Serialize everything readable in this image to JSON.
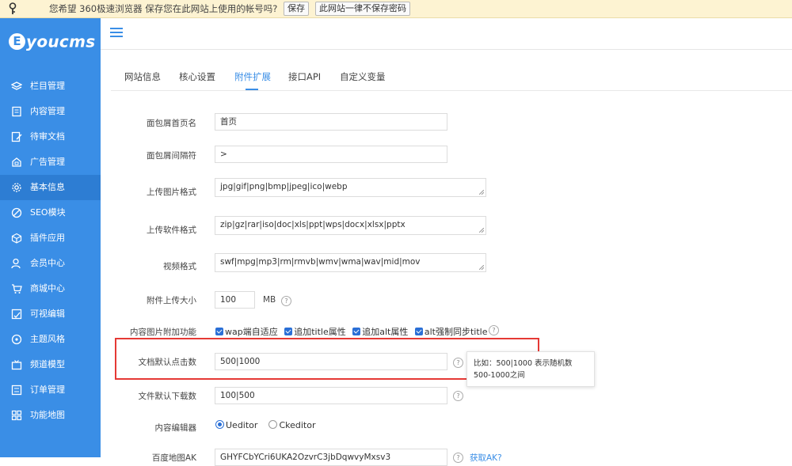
{
  "password_bar": {
    "message": "您希望 360极速浏览器 保存您在此网站上使用的帐号吗?",
    "save_label": "保存",
    "never_label": "此网站一律不保存密码"
  },
  "brand": {
    "logo_text": "youcms",
    "logo_letter": "E"
  },
  "sidebar": {
    "items": [
      {
        "label": "栏目管理",
        "icon": "layers-icon"
      },
      {
        "label": "内容管理",
        "icon": "document-icon"
      },
      {
        "label": "待审文档",
        "icon": "edit-doc-icon"
      },
      {
        "label": "广告管理",
        "icon": "ad-icon"
      },
      {
        "label": "基本信息",
        "icon": "gear-icon"
      },
      {
        "label": "SEO模块",
        "icon": "seo-icon"
      },
      {
        "label": "插件应用",
        "icon": "cube-icon"
      },
      {
        "label": "会员中心",
        "icon": "user-icon"
      },
      {
        "label": "商城中心",
        "icon": "cart-icon"
      },
      {
        "label": "可视编辑",
        "icon": "visual-edit-icon"
      },
      {
        "label": "主题风格",
        "icon": "palette-icon"
      },
      {
        "label": "频道模型",
        "icon": "tv-icon"
      },
      {
        "label": "订单管理",
        "icon": "list-icon"
      },
      {
        "label": "功能地图",
        "icon": "grid-icon"
      }
    ],
    "active_item": "基本信息"
  },
  "tabs": [
    {
      "label": "网站信息"
    },
    {
      "label": "核心设置"
    },
    {
      "label": "附件扩展"
    },
    {
      "label": "接口API"
    },
    {
      "label": "自定义变量"
    }
  ],
  "active_tab": "附件扩展",
  "form": {
    "breadcrumb_home": {
      "label": "面包屑首页名",
      "value": "首页"
    },
    "breadcrumb_sep": {
      "label": "面包屑间隔符",
      "value": ">"
    },
    "image_types": {
      "label": "上传图片格式",
      "value": "jpg|gif|png|bmp|jpeg|ico|webp"
    },
    "software_types": {
      "label": "上传软件格式",
      "value": "zip|gz|rar|iso|doc|xls|ppt|wps|docx|xlsx|pptx"
    },
    "video_types": {
      "label": "视频格式",
      "value": "swf|mpg|mp3|rm|rmvb|wmv|wma|wav|mid|mov"
    },
    "upload_size": {
      "label": "附件上传大小",
      "value": "100",
      "unit": "MB"
    },
    "image_features": {
      "label": "内容图片附加功能",
      "options": [
        {
          "label": "wap端自适应",
          "checked": true
        },
        {
          "label": "追加title属性",
          "checked": true
        },
        {
          "label": "追加alt属性",
          "checked": true
        },
        {
          "label": "alt强制同步title",
          "checked": true
        }
      ]
    },
    "default_clicks": {
      "label": "文档默认点击数",
      "value": "500|1000",
      "tooltip": "比如：500|1000 表示随机数500-1000之间"
    },
    "default_downloads": {
      "label": "文件默认下载数",
      "value": "100|500"
    },
    "editor": {
      "label": "内容编辑器",
      "options": [
        {
          "label": "Ueditor",
          "selected": true
        },
        {
          "label": "Ckeditor",
          "selected": false
        }
      ]
    },
    "baidu_map": {
      "label": "百度地图AK",
      "value": "GHYFCbYCri6UKA2OzvrC3jbDqwvyMxsv3",
      "link": "获取AK?"
    }
  },
  "colors": {
    "accent": "#3a8ee6",
    "sidebar_bg": "#3a8ee6",
    "highlight_border": "#e53935"
  }
}
